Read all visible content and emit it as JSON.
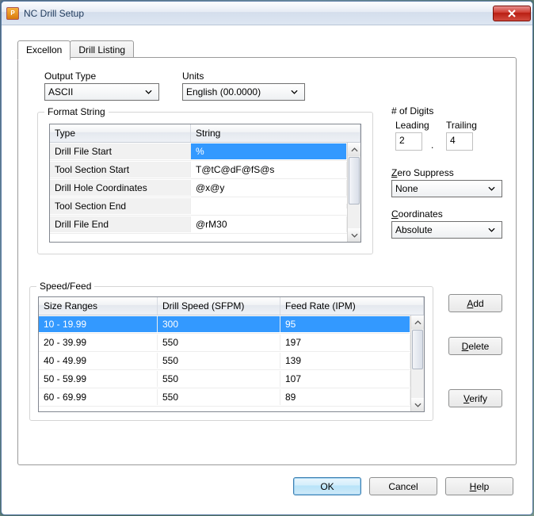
{
  "window": {
    "title": "NC Drill Setup"
  },
  "tabs": {
    "excellon": "Excellon",
    "drill_listing": "Drill Listing",
    "active": "excellon"
  },
  "output_type": {
    "label": "Output Type",
    "value": "ASCII"
  },
  "units": {
    "label": "Units",
    "value": "English (00.0000)"
  },
  "format_string": {
    "legend": "Format String",
    "headers": {
      "type": "Type",
      "string": "String"
    },
    "rows": [
      {
        "type": "Drill File Start",
        "string": "%",
        "selected": true
      },
      {
        "type": "Tool Section Start",
        "string": "T@tC@dF@fS@s"
      },
      {
        "type": "Drill Hole Coordinates",
        "string": "@x@y"
      },
      {
        "type": "Tool Section End",
        "string": ""
      },
      {
        "type": "Drill File End",
        "string": "@rM30"
      }
    ]
  },
  "digits": {
    "legend": "# of Digits",
    "leading_label": "Leading",
    "leading": "2",
    "trailing_label": "Trailing",
    "trailing": "4"
  },
  "zero_suppress": {
    "label": "Zero Suppress",
    "value": "None"
  },
  "coordinates": {
    "label": "Coordinates",
    "value": "Absolute"
  },
  "speed_feed": {
    "legend": "Speed/Feed",
    "headers": {
      "size": "Size Ranges",
      "speed": "Drill Speed (SFPM)",
      "feed": "Feed Rate (IPM)"
    },
    "rows": [
      {
        "size": "10 - 19.99",
        "speed": "300",
        "feed": "95",
        "selected": true
      },
      {
        "size": "20 - 39.99",
        "speed": "550",
        "feed": "197"
      },
      {
        "size": "40 - 49.99",
        "speed": "550",
        "feed": "139"
      },
      {
        "size": "50 - 59.99",
        "speed": "550",
        "feed": "107"
      },
      {
        "size": "60 - 69.99",
        "speed": "550",
        "feed": "89"
      }
    ]
  },
  "buttons": {
    "add": "Add",
    "delete": "Delete",
    "verify": "Verify",
    "ok": "OK",
    "cancel": "Cancel",
    "help": "Help"
  }
}
